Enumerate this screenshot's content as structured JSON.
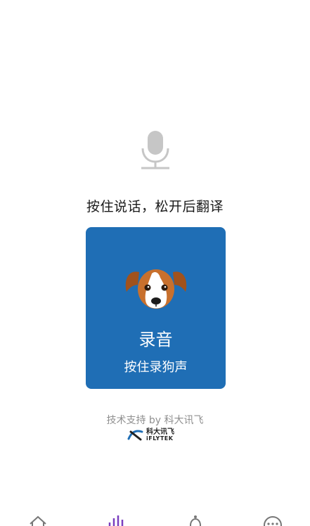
{
  "instruction": "按住说话，松开后翻译",
  "record_button": {
    "title": "录音",
    "subtitle": "按住录狗声"
  },
  "footer": {
    "support_text": "技术支持 by 科大讯飞",
    "brand_cn": "科大讯飞",
    "brand_en": "iFLYTEK"
  },
  "colors": {
    "accent": "#1f6eb5",
    "active_tab": "#7b3fbf"
  },
  "tabs": [
    {
      "icon": "home-icon"
    },
    {
      "icon": "sound-wave-icon"
    },
    {
      "icon": "bell-icon"
    },
    {
      "icon": "more-icon"
    }
  ]
}
